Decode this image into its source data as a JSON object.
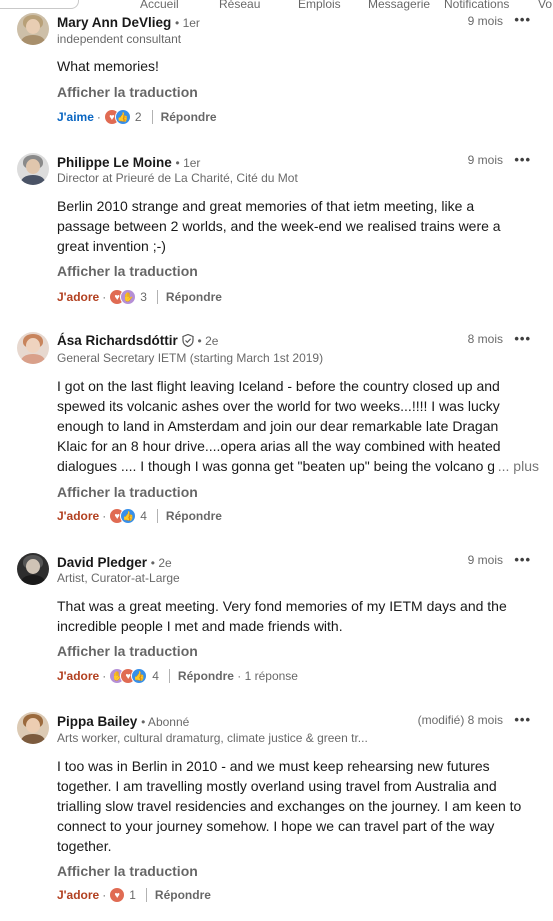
{
  "nav": {
    "items": [
      "Accueil",
      "Réseau",
      "Emplois",
      "Messagerie",
      "Notifications",
      "Vo"
    ]
  },
  "colors": {
    "like_blue": "#0a66c2",
    "adore_red": "#b24020",
    "muted": "#666666"
  },
  "labels": {
    "translate": "Afficher la traduction",
    "reply": "Répondre",
    "more_menu": "•••",
    "see_more": "... plus"
  },
  "comments": [
    {
      "name": "Mary Ann DeVlieg",
      "degree": "• 1er",
      "headline": "independent consultant",
      "time": "9 mois",
      "text": "What memories!",
      "reaction_label": "J'aime",
      "reaction_icons": [
        "heart",
        "like"
      ],
      "count": "2",
      "replies": ""
    },
    {
      "name": "Philippe Le Moine",
      "degree": "• 1er",
      "headline": "Director at Prieuré de La Charité, Cité du Mot",
      "time": "9 mois",
      "text": "Berlin 2010 strange and great memories of that ietm meeting, like a passage between 2 worlds, and the week-end we realised trains were a great invention ;-)",
      "reaction_label": "J'adore",
      "reaction_icons": [
        "heart",
        "support"
      ],
      "count": "3",
      "replies": ""
    },
    {
      "name": "Ása Richardsdóttir",
      "degree": "• 2e",
      "headline": "General Secretary IETM (starting March 1st 2019)",
      "time": "8 mois",
      "text": "I got on the last flight leaving Iceland - before the country closed up and spewed its volcanic ashes over the world for two weeks...!!!! I was lucky enough to land in Amsterdam and join our dear remarkable late Dragan Klaic for an 8 hour drive....opera arias all the way combined with heated dialogues .... I though I was gonna get \"beaten up\" being the volcano girl...",
      "reaction_label": "J'adore",
      "reaction_icons": [
        "heart",
        "like"
      ],
      "count": "4",
      "replies": ""
    },
    {
      "name": "David Pledger",
      "degree": "• 2e",
      "headline": "Artist, Curator-at-Large",
      "time": "9 mois",
      "text": "That was a great meeting. Very fond memories of my IETM days and the incredible people I met and made friends with.",
      "reaction_label": "J'adore",
      "reaction_icons": [
        "support",
        "heart",
        "like"
      ],
      "count": "4",
      "replies": "· 1 réponse"
    },
    {
      "name": "Pippa Bailey",
      "degree": "• Abonné",
      "headline": "Arts worker, cultural dramaturg, climate justice & green tr...",
      "time": "(modifié) 8 mois",
      "text": "I too was in Berlin in 2010 - and we must keep rehearsing new futures together. I am travelling mostly overland using travel from Australia and trialling slow travel residencies and exchanges on the journey. I am keen to connect to your journey somehow. I hope we can travel part of the way together.",
      "reaction_label": "J'adore",
      "reaction_icons": [
        "heart"
      ],
      "count": "1",
      "replies": ""
    }
  ]
}
